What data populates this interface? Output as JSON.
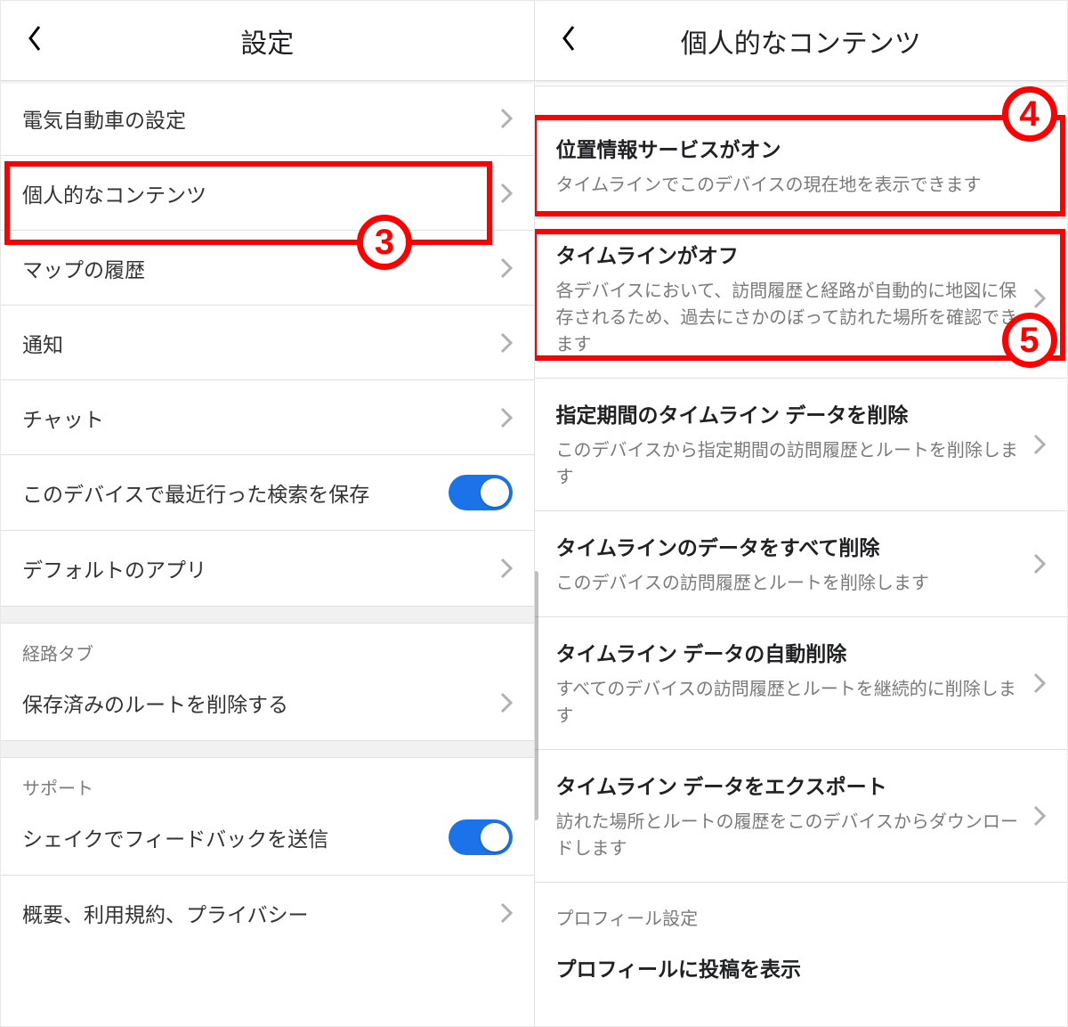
{
  "left": {
    "title": "設定",
    "items": [
      {
        "label": "電気自動車の設定",
        "type": "nav"
      },
      {
        "label": "個人的なコンテンツ",
        "type": "nav"
      },
      {
        "label": "マップの履歴",
        "type": "nav"
      },
      {
        "label": "通知",
        "type": "nav"
      },
      {
        "label": "チャット",
        "type": "nav"
      },
      {
        "label": "このデバイスで最近行った検索を保存",
        "type": "toggle",
        "on": true
      },
      {
        "label": "デフォルトのアプリ",
        "type": "nav"
      }
    ],
    "section_route": {
      "header": "経路タブ",
      "item": "保存済みのルートを削除する"
    },
    "section_support": {
      "header": "サポート",
      "items": [
        {
          "label": "シェイクでフィードバックを送信",
          "type": "toggle",
          "on": true
        },
        {
          "label": "概要、利用規約、プライバシー",
          "type": "nav"
        }
      ]
    }
  },
  "right": {
    "title": "個人的なコンテンツ",
    "items": [
      {
        "title": "位置情報サービスがオン",
        "sub": "タイムラインでこのデバイスの現在地を表示できます",
        "chevron": false
      },
      {
        "title": "タイムラインがオフ",
        "sub": "各デバイスにおいて、訪問履歴と経路が自動的に地図に保存されるため、過去にさかのぼって訪れた場所を確認できます",
        "chevron": true
      },
      {
        "title": "指定期間のタイムライン データを削除",
        "sub": "このデバイスから指定期間の訪問履歴とルートを削除します",
        "chevron": true
      },
      {
        "title": "タイムラインのデータをすべて削除",
        "sub": "このデバイスの訪問履歴とルートを削除します",
        "chevron": true
      },
      {
        "title": "タイムライン データの自動削除",
        "sub": "すべてのデバイスの訪問履歴とルートを継続的に削除します",
        "chevron": true
      },
      {
        "title": "タイムライン データをエクスポート",
        "sub": "訪れた場所とルートの履歴をこのデバイスからダウンロードします",
        "chevron": true
      }
    ],
    "profile_section": {
      "header": "プロフィール設定",
      "item": "プロフィールに投稿を表示"
    }
  },
  "annotations": {
    "n3": "3",
    "n4": "4",
    "n5": "5"
  }
}
